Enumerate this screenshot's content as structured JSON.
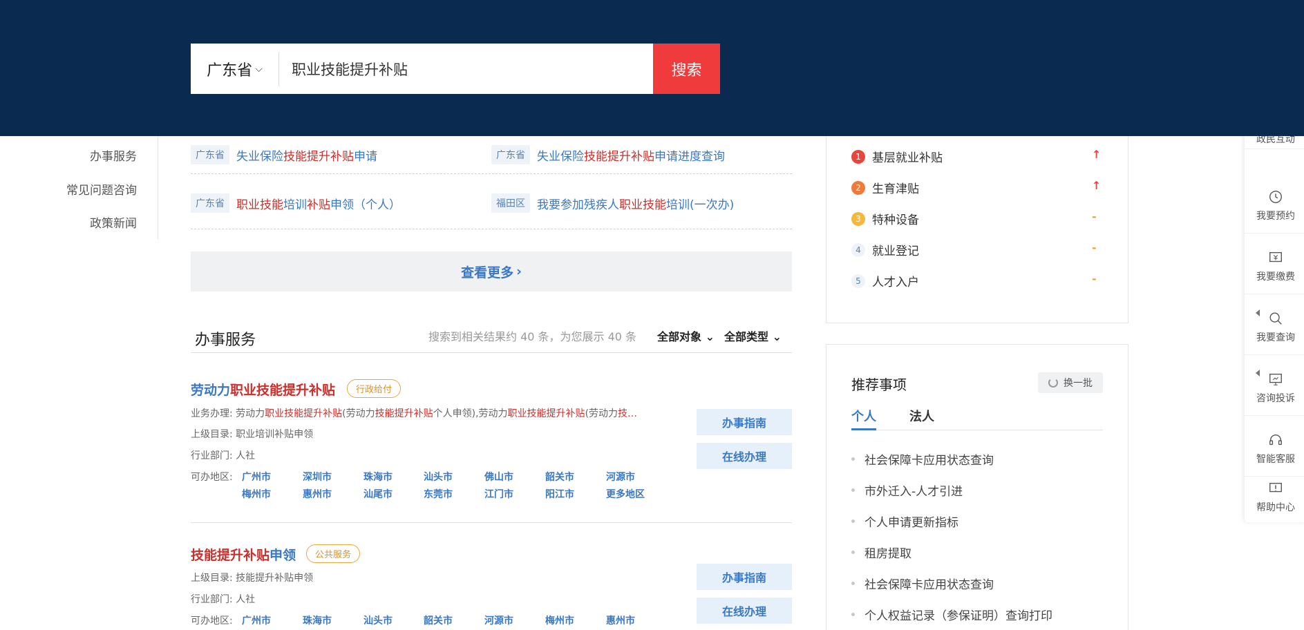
{
  "search": {
    "region": "广东省",
    "query": "职业技能提升补贴",
    "button": "搜索"
  },
  "left_nav": [
    "办事服务",
    "常见问题咨询",
    "政策新闻"
  ],
  "top_results": [
    {
      "tag": "广东省",
      "pre": "失业保险",
      "hl": "技能提升补贴",
      "post": "申请"
    },
    {
      "tag": "广东省",
      "pre": "失业保险",
      "hl": "技能提升补贴",
      "post": "申请进度查询"
    },
    {
      "tag": "广东省",
      "text_parts": [
        "职业技能",
        "培训",
        "补贴",
        "申领（个人）"
      ]
    },
    {
      "tag": "福田区",
      "pre": "我要参加残疾人",
      "hl": "职业技能",
      "post": "培训(一次办)"
    }
  ],
  "more_label": "查看更多",
  "section": {
    "title": "办事服务",
    "info": "搜索到相关结果约 40 条，为您展示 40 条",
    "filter_object": "全部对象",
    "filter_type": "全部类型"
  },
  "cards": [
    {
      "title_blue": "劳动力",
      "title_red": "职业技能提升补贴",
      "badge": "行政给付",
      "business_label": "业务办理:",
      "business_parts": [
        "劳动力",
        "职业技能提升补贴",
        "(劳动力",
        "技能提升补贴",
        "个人申领),劳动力",
        "职业技能提升补贴",
        "(劳动力",
        "技…"
      ],
      "catalog_label": "上级目录:",
      "catalog": "职业培训补贴申领",
      "dept_label": "行业部门:",
      "dept": "人社",
      "area_label": "可办地区:",
      "cities": [
        "广州市",
        "深圳市",
        "珠海市",
        "汕头市",
        "佛山市",
        "韶关市",
        "河源市",
        "梅州市",
        "惠州市",
        "汕尾市",
        "东莞市",
        "江门市",
        "阳江市",
        "更多地区"
      ],
      "guide": "办事指南",
      "online": "在线办理"
    },
    {
      "title_red": "技能提升补贴",
      "title_blue": "申领",
      "badge": "公共服务",
      "catalog_label": "上级目录:",
      "catalog": "技能提升补贴申领",
      "dept_label": "行业部门:",
      "dept": "人社",
      "area_label": "可办地区:",
      "cities": [
        "广州市",
        "珠海市",
        "汕头市",
        "韶关市",
        "河源市",
        "梅州市",
        "惠州市"
      ],
      "guide": "办事指南",
      "online": "在线办理"
    }
  ],
  "hot_list": [
    {
      "rank": "1",
      "label": "基层就业补贴",
      "trend": "↑",
      "color": "#e8453c"
    },
    {
      "rank": "2",
      "label": "生育津贴",
      "trend": "↑",
      "color": "#f07a3a"
    },
    {
      "rank": "3",
      "label": "特种设备",
      "trend": "-",
      "color": "#f5b83d"
    },
    {
      "rank": "4",
      "label": "就业登记",
      "trend": "-",
      "color": ""
    },
    {
      "rank": "5",
      "label": "人才入户",
      "trend": "-",
      "color": ""
    }
  ],
  "recommend": {
    "title": "推荐事项",
    "swap": "换一批",
    "tabs": [
      "个人",
      "法人"
    ],
    "items": [
      "社会保障卡应用状态查询",
      "市外迁入-人才引进",
      "个人申请更新指标",
      "租房提取",
      "社会保障卡应用状态查询",
      "个人权益记录（参保证明）查询打印"
    ]
  },
  "float_bar": [
    "政民互动",
    "我要预约",
    "我要缴费",
    "我要查询",
    "咨询投诉",
    "智能客服",
    "帮助中心"
  ],
  "colors": {
    "header_bg": "#0b2a4f",
    "search_btn": "#ef3b3b",
    "link_blue": "#3a78c3",
    "highlight_red": "#c9302c"
  }
}
